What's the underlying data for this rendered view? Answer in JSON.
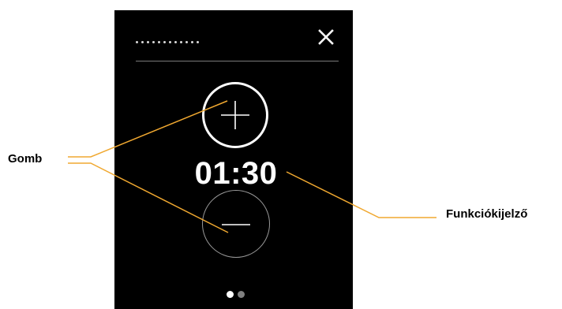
{
  "display": {
    "time": "01:30",
    "title_dots": 12,
    "page_indicator": {
      "total": 2,
      "active": 1
    }
  },
  "icons": {
    "close": "close-icon",
    "plus": "plus-icon",
    "minus": "minus-icon"
  },
  "callouts": {
    "button_label": "Gomb",
    "display_label": "Funkciókijelző"
  },
  "colors": {
    "screen_background": "#000000",
    "text": "#ffffff",
    "leader_line": "#f0a830",
    "inactive_dot": "#808080",
    "active_dot": "#ffffff",
    "divider": "#7a7a7a"
  }
}
